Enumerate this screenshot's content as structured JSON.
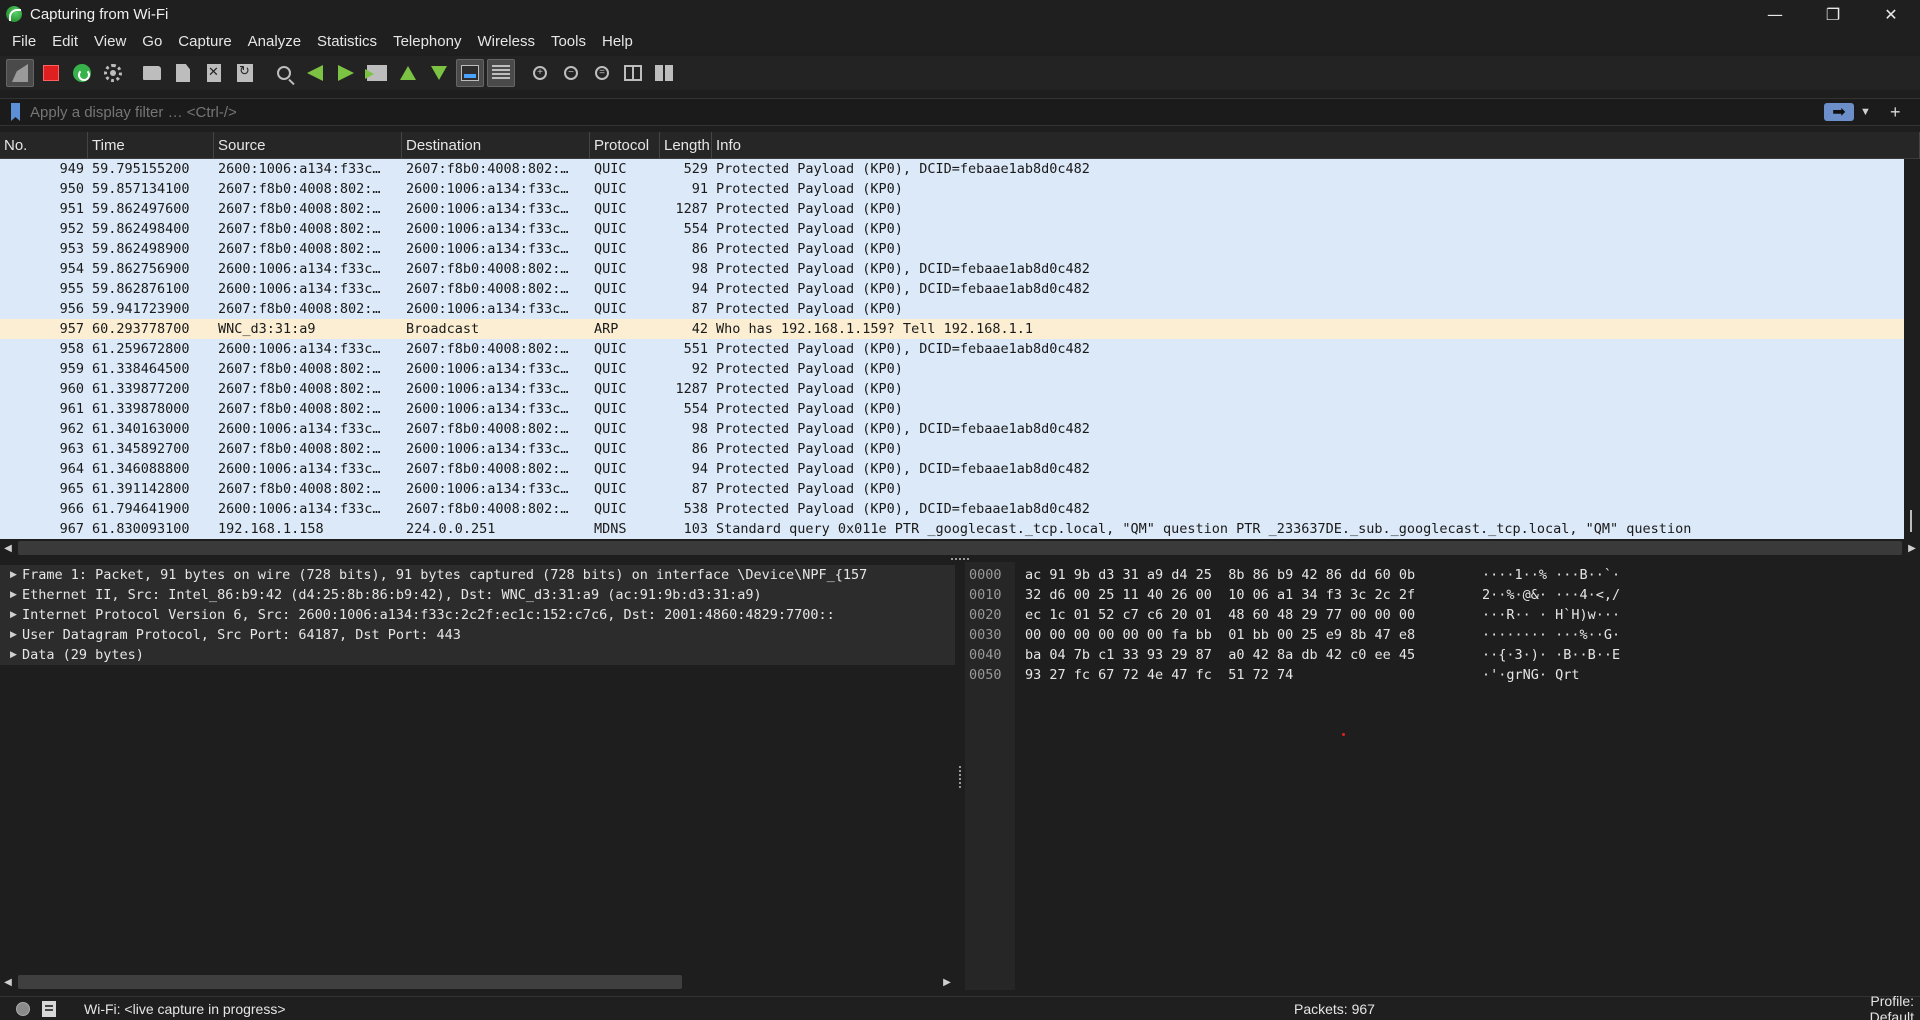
{
  "window": {
    "title": "Capturing from Wi-Fi",
    "controls": {
      "minimize": "—",
      "maximize": "❐",
      "close": "✕"
    }
  },
  "menubar": [
    "File",
    "Edit",
    "View",
    "Go",
    "Capture",
    "Analyze",
    "Statistics",
    "Telephony",
    "Wireless",
    "Tools",
    "Help"
  ],
  "toolbar": {
    "icons": [
      "shark-fin-start-icon",
      "stop-capture-icon",
      "restart-capture-icon",
      "capture-options-icon",
      "open-file-icon",
      "save-file-icon",
      "close-file-icon",
      "reload-file-icon",
      "find-packet-icon",
      "go-back-icon",
      "go-forward-icon",
      "go-to-packet-icon",
      "go-first-icon",
      "go-last-icon",
      "auto-scroll-icon",
      "colorize-icon",
      "zoom-in-icon",
      "zoom-out-icon",
      "normal-size-icon",
      "resize-columns-icon",
      "layout-icon"
    ]
  },
  "filter": {
    "placeholder": "Apply a display filter … <Ctrl-/>",
    "value": ""
  },
  "packet_list": {
    "columns": [
      "No.",
      "Time",
      "Source",
      "Destination",
      "Protocol",
      "Length",
      "Info"
    ],
    "rows": [
      {
        "no": "949",
        "time": "59.795155200",
        "src": "2600:1006:a134:f33c…",
        "dst": "2607:f8b0:4008:802:…",
        "proto": "QUIC",
        "len": "529",
        "info": "Protected Payload (KP0), DCID=febaae1ab8d0c482",
        "color": "quic"
      },
      {
        "no": "950",
        "time": "59.857134100",
        "src": "2607:f8b0:4008:802:…",
        "dst": "2600:1006:a134:f33c…",
        "proto": "QUIC",
        "len": "91",
        "info": "Protected Payload (KP0)",
        "color": "quic"
      },
      {
        "no": "951",
        "time": "59.862497600",
        "src": "2607:f8b0:4008:802:…",
        "dst": "2600:1006:a134:f33c…",
        "proto": "QUIC",
        "len": "1287",
        "info": "Protected Payload (KP0)",
        "color": "quic"
      },
      {
        "no": "952",
        "time": "59.862498400",
        "src": "2607:f8b0:4008:802:…",
        "dst": "2600:1006:a134:f33c…",
        "proto": "QUIC",
        "len": "554",
        "info": "Protected Payload (KP0)",
        "color": "quic"
      },
      {
        "no": "953",
        "time": "59.862498900",
        "src": "2607:f8b0:4008:802:…",
        "dst": "2600:1006:a134:f33c…",
        "proto": "QUIC",
        "len": "86",
        "info": "Protected Payload (KP0)",
        "color": "quic"
      },
      {
        "no": "954",
        "time": "59.862756900",
        "src": "2600:1006:a134:f33c…",
        "dst": "2607:f8b0:4008:802:…",
        "proto": "QUIC",
        "len": "98",
        "info": "Protected Payload (KP0), DCID=febaae1ab8d0c482",
        "color": "quic"
      },
      {
        "no": "955",
        "time": "59.862876100",
        "src": "2600:1006:a134:f33c…",
        "dst": "2607:f8b0:4008:802:…",
        "proto": "QUIC",
        "len": "94",
        "info": "Protected Payload (KP0), DCID=febaae1ab8d0c482",
        "color": "quic"
      },
      {
        "no": "956",
        "time": "59.941723900",
        "src": "2607:f8b0:4008:802:…",
        "dst": "2600:1006:a134:f33c…",
        "proto": "QUIC",
        "len": "87",
        "info": "Protected Payload (KP0)",
        "color": "quic"
      },
      {
        "no": "957",
        "time": "60.293778700",
        "src": "WNC_d3:31:a9",
        "dst": "Broadcast",
        "proto": "ARP",
        "len": "42",
        "info": "Who has 192.168.1.159? Tell 192.168.1.1",
        "color": "arp"
      },
      {
        "no": "958",
        "time": "61.259672800",
        "src": "2600:1006:a134:f33c…",
        "dst": "2607:f8b0:4008:802:…",
        "proto": "QUIC",
        "len": "551",
        "info": "Protected Payload (KP0), DCID=febaae1ab8d0c482",
        "color": "quic"
      },
      {
        "no": "959",
        "time": "61.338464500",
        "src": "2607:f8b0:4008:802:…",
        "dst": "2600:1006:a134:f33c…",
        "proto": "QUIC",
        "len": "92",
        "info": "Protected Payload (KP0)",
        "color": "quic"
      },
      {
        "no": "960",
        "time": "61.339877200",
        "src": "2607:f8b0:4008:802:…",
        "dst": "2600:1006:a134:f33c…",
        "proto": "QUIC",
        "len": "1287",
        "info": "Protected Payload (KP0)",
        "color": "quic"
      },
      {
        "no": "961",
        "time": "61.339878000",
        "src": "2607:f8b0:4008:802:…",
        "dst": "2600:1006:a134:f33c…",
        "proto": "QUIC",
        "len": "554",
        "info": "Protected Payload (KP0)",
        "color": "quic"
      },
      {
        "no": "962",
        "time": "61.340163000",
        "src": "2600:1006:a134:f33c…",
        "dst": "2607:f8b0:4008:802:…",
        "proto": "QUIC",
        "len": "98",
        "info": "Protected Payload (KP0), DCID=febaae1ab8d0c482",
        "color": "quic"
      },
      {
        "no": "963",
        "time": "61.345892700",
        "src": "2607:f8b0:4008:802:…",
        "dst": "2600:1006:a134:f33c…",
        "proto": "QUIC",
        "len": "86",
        "info": "Protected Payload (KP0)",
        "color": "quic"
      },
      {
        "no": "964",
        "time": "61.346088800",
        "src": "2600:1006:a134:f33c…",
        "dst": "2607:f8b0:4008:802:…",
        "proto": "QUIC",
        "len": "94",
        "info": "Protected Payload (KP0), DCID=febaae1ab8d0c482",
        "color": "quic"
      },
      {
        "no": "965",
        "time": "61.391142800",
        "src": "2607:f8b0:4008:802:…",
        "dst": "2600:1006:a134:f33c…",
        "proto": "QUIC",
        "len": "87",
        "info": "Protected Payload (KP0)",
        "color": "quic"
      },
      {
        "no": "966",
        "time": "61.794641900",
        "src": "2600:1006:a134:f33c…",
        "dst": "2607:f8b0:4008:802:…",
        "proto": "QUIC",
        "len": "538",
        "info": "Protected Payload (KP0), DCID=febaae1ab8d0c482",
        "color": "quic"
      },
      {
        "no": "967",
        "time": "61.830093100",
        "src": "192.168.1.158",
        "dst": "224.0.0.251",
        "proto": "MDNS",
        "len": "103",
        "info": "Standard query 0x011e PTR _googlecast._tcp.local, \"QM\" question PTR _233637DE._sub._googlecast._tcp.local, \"QM\" question",
        "color": "quic"
      }
    ]
  },
  "details": [
    "Frame 1: Packet, 91 bytes on wire (728 bits), 91 bytes captured (728 bits) on interface \\Device\\NPF_{157",
    "Ethernet II, Src: Intel_86:b9:42 (d4:25:8b:86:b9:42), Dst: WNC_d3:31:a9 (ac:91:9b:d3:31:a9)",
    "Internet Protocol Version 6, Src: 2600:1006:a134:f33c:2c2f:ec1c:152:c7c6, Dst: 2001:4860:4829:7700::",
    "User Datagram Protocol, Src Port: 64187, Dst Port: 443",
    "Data (29 bytes)"
  ],
  "bytes": {
    "offsets": [
      "0000",
      "0010",
      "0020",
      "0030",
      "0040",
      "0050"
    ],
    "hex": [
      "ac 91 9b d3 31 a9 d4 25  8b 86 b9 42 86 dd 60 0b",
      "32 d6 00 25 11 40 26 00  10 06 a1 34 f3 3c 2c 2f",
      "ec 1c 01 52 c7 c6 20 01  48 60 48 29 77 00 00 00",
      "00 00 00 00 00 00 fa bb  01 bb 00 25 e9 8b 47 e8",
      "ba 04 7b c1 33 93 29 87  a0 42 8a db 42 c0 ee 45",
      "93 27 fc 67 72 4e 47 fc  51 72 74"
    ],
    "ascii": [
      "····1··% ···B··`·",
      "2··%·@&· ···4·<,/",
      "···R·· · H`H)w···",
      "········ ···%··G·",
      "··{·3·)· ·B··B··E",
      "·'·grNG· Qrt"
    ]
  },
  "status": {
    "capture": "Wi-Fi: <live capture in progress>",
    "packets": "Packets: 967",
    "profile": "Profile: Default"
  }
}
